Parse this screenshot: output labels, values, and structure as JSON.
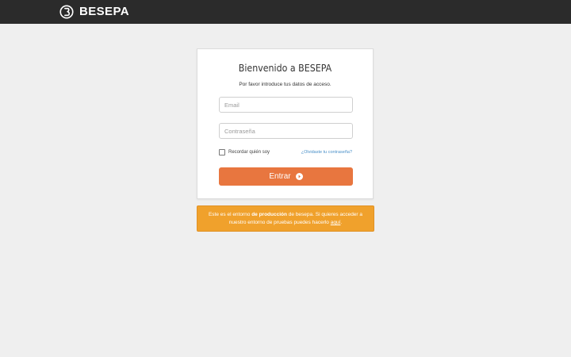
{
  "header": {
    "brand_name": "BESEPA",
    "logo_icon": "besepa-logo-icon",
    "background": "#2b2b2b"
  },
  "login": {
    "title": "Bienvenido a BESEPA",
    "subtitle": "Por favor introduce tus datos de acceso.",
    "email": {
      "placeholder": "Email",
      "value": ""
    },
    "password": {
      "placeholder": "Contraseña",
      "value": ""
    },
    "remember_label": "Recordar quién soy",
    "remember_checked": false,
    "forgot_link": "¿Olvidaste tu contraseña?",
    "submit_label": "Entrar",
    "submit_icon": "arrow-circle-right-icon",
    "submit_color": "#e8763f"
  },
  "notice": {
    "text_before": "Este es el entorno",
    "text_bold": "de producción",
    "text_middle": "de besepa. Si quieres acceder a nuestro entorno de pruebas puedes hacerlo",
    "link_text": "aquí",
    "text_end": ".",
    "background": "#f0a12c"
  }
}
